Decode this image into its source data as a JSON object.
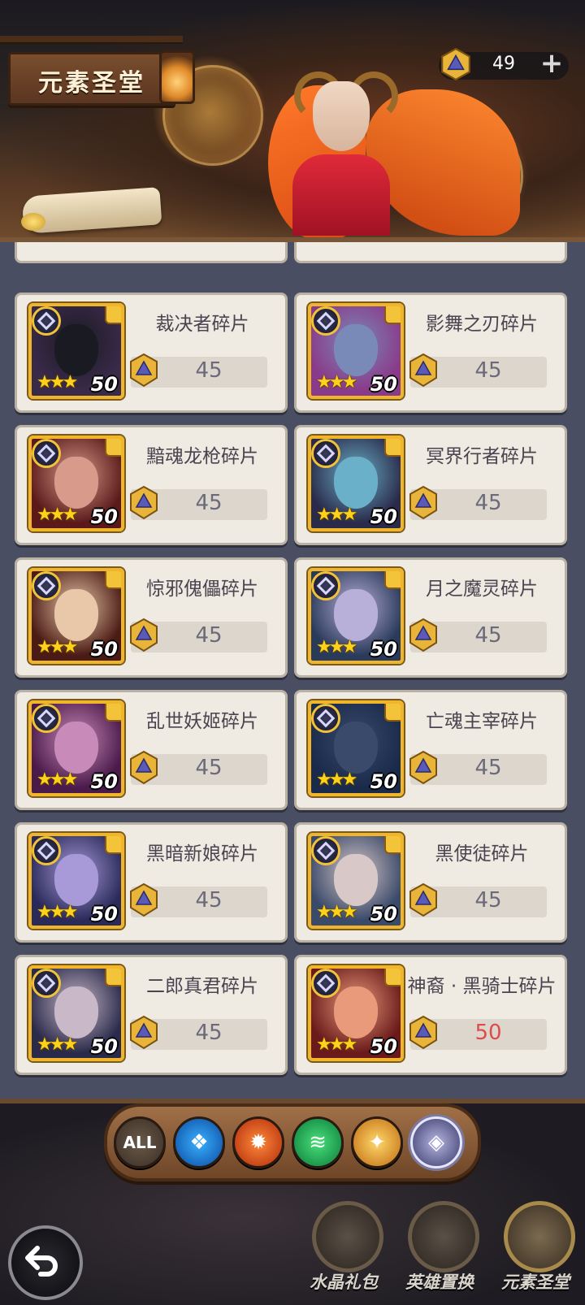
{
  "header": {
    "title": "元素圣堂",
    "currency_icon": "crystal-gem-icon",
    "currency_amount": "49",
    "add_label": "+"
  },
  "cards": [
    {
      "name": "裁决者碎片",
      "price": "45",
      "level": "50",
      "stars": 3,
      "portrait_color": "#3a2a4a",
      "face_color": "#1a1a22",
      "affordable": true
    },
    {
      "name": "影舞之刃碎片",
      "price": "45",
      "level": "50",
      "stars": 3,
      "portrait_color": "#8a3a8a",
      "face_color": "#7a8ab8",
      "affordable": true
    },
    {
      "name": "黯魂龙枪碎片",
      "price": "45",
      "level": "50",
      "stars": 3,
      "portrait_color": "#5a1a1a",
      "face_color": "#d89a8a",
      "affordable": true
    },
    {
      "name": "冥界行者碎片",
      "price": "45",
      "level": "50",
      "stars": 3,
      "portrait_color": "#2a2a4a",
      "face_color": "#6ab0c8",
      "affordable": true
    },
    {
      "name": "惊邪傀儡碎片",
      "price": "45",
      "level": "50",
      "stars": 3,
      "portrait_color": "#4a1a14",
      "face_color": "#e8c8a8",
      "affordable": true
    },
    {
      "name": "月之魔灵碎片",
      "price": "45",
      "level": "50",
      "stars": 3,
      "portrait_color": "#2a3a5a",
      "face_color": "#b8b0d8",
      "affordable": true
    },
    {
      "name": "乱世妖姬碎片",
      "price": "45",
      "level": "50",
      "stars": 3,
      "portrait_color": "#4a1a4a",
      "face_color": "#c88ab8",
      "affordable": true
    },
    {
      "name": "亡魂主宰碎片",
      "price": "45",
      "level": "50",
      "stars": 3,
      "portrait_color": "#1a2a4a",
      "face_color": "#3a4a6a",
      "affordable": true
    },
    {
      "name": "黑暗新娘碎片",
      "price": "45",
      "level": "50",
      "stars": 3,
      "portrait_color": "#2a2a5a",
      "face_color": "#a89ad8",
      "affordable": true
    },
    {
      "name": "黑使徒碎片",
      "price": "45",
      "level": "50",
      "stars": 3,
      "portrait_color": "#3a4a6a",
      "face_color": "#d8c8c8",
      "affordable": true
    },
    {
      "name": "二郎真君碎片",
      "price": "45",
      "level": "50",
      "stars": 3,
      "portrait_color": "#2a2a4a",
      "face_color": "#c8b8c8",
      "affordable": true
    },
    {
      "name": "神裔 · 黑骑士碎片",
      "price": "50",
      "level": "50",
      "stars": 3,
      "portrait_color": "#6a1a1a",
      "face_color": "#e89a7a",
      "affordable": false
    }
  ],
  "filters": [
    {
      "key": "all",
      "label": "ALL",
      "icon": "all-elements-icon"
    },
    {
      "key": "water",
      "label": "",
      "icon": "water-element-icon"
    },
    {
      "key": "fire",
      "label": "",
      "icon": "fire-element-icon"
    },
    {
      "key": "wind",
      "label": "",
      "icon": "wind-element-icon"
    },
    {
      "key": "light",
      "label": "",
      "icon": "light-element-icon"
    },
    {
      "key": "dark",
      "label": "",
      "icon": "dark-element-icon",
      "selected": true
    }
  ],
  "bottom_nav": [
    {
      "label": "水晶礼包",
      "icon": "crystal-pack-icon"
    },
    {
      "label": "英雄置换",
      "icon": "hero-swap-icon"
    },
    {
      "label": "元素圣堂",
      "icon": "element-sanctum-icon",
      "active": true
    }
  ],
  "colors": {
    "price_unaffordable": "#e04a4a",
    "price_normal": "#6a6a7a",
    "card_bg": "#efeae2",
    "list_bg": "#4a4e62"
  }
}
